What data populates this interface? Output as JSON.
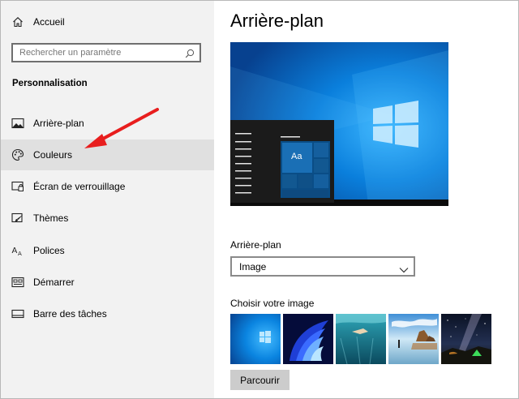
{
  "sidebar": {
    "home": {
      "label": "Accueil",
      "icon": "home-icon"
    },
    "search": {
      "placeholder": "Rechercher un paramètre",
      "icon": "search-icon"
    },
    "section_title": "Personnalisation",
    "items": [
      {
        "label": "Arrière-plan",
        "icon": "picture-icon",
        "selected": false
      },
      {
        "label": "Couleurs",
        "icon": "palette-icon",
        "selected": true
      },
      {
        "label": "Écran de verrouillage",
        "icon": "lock-screen-icon",
        "selected": false
      },
      {
        "label": "Thèmes",
        "icon": "brush-icon",
        "selected": false
      },
      {
        "label": "Polices",
        "icon": "font-icon",
        "selected": false
      },
      {
        "label": "Démarrer",
        "icon": "start-icon",
        "selected": false
      },
      {
        "label": "Barre des tâches",
        "icon": "taskbar-icon",
        "selected": false
      }
    ]
  },
  "main": {
    "title": "Arrière-plan",
    "preview": {
      "tile_label": "Aa"
    },
    "background_label": "Arrière-plan",
    "background_value": "Image",
    "choose_label": "Choisir votre image",
    "thumbnails": [
      {
        "name": "windows-blue"
      },
      {
        "name": "blue-bloom"
      },
      {
        "name": "underwater-swimmer"
      },
      {
        "name": "beach-rocks"
      },
      {
        "name": "night-sky-tent"
      }
    ],
    "browse_label": "Parcourir"
  },
  "colors": {
    "accent": "#0078d7",
    "sidebar_bg": "#f2f2f2",
    "selected_bg": "#e0e0e0",
    "arrow": "#e81e1e"
  }
}
